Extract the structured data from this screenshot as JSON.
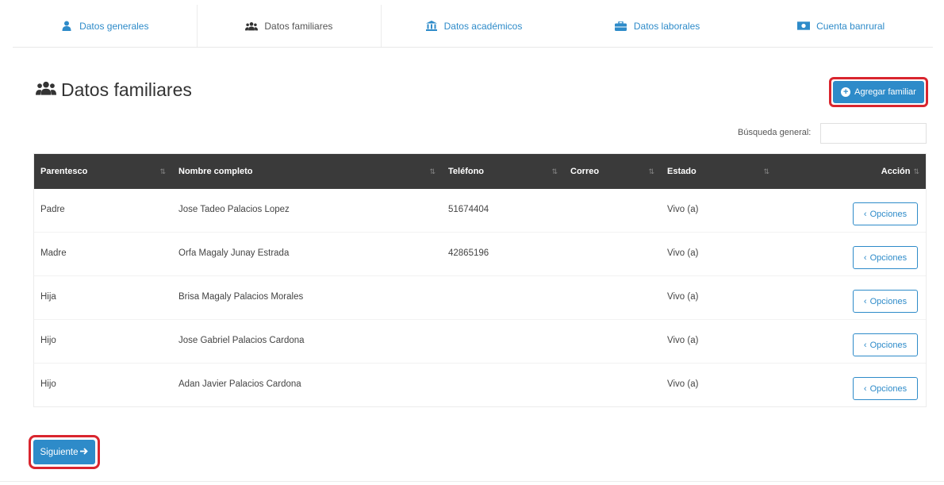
{
  "tabs": [
    {
      "label": "Datos generales",
      "icon": "user-icon"
    },
    {
      "label": "Datos familiares",
      "icon": "users-icon"
    },
    {
      "label": "Datos académicos",
      "icon": "institution-icon"
    },
    {
      "label": "Datos laborales",
      "icon": "briefcase-icon"
    },
    {
      "label": "Cuenta banrural",
      "icon": "money-icon"
    }
  ],
  "active_tab": "Datos familiares",
  "header": {
    "title": "Datos familiares",
    "add_button_label": "Agregar familiar"
  },
  "search": {
    "label": "Búsqueda general:",
    "value": ""
  },
  "table": {
    "columns": [
      "Parentesco",
      "Nombre completo",
      "Teléfono",
      "Correo",
      "Estado",
      "Acción"
    ],
    "rows": [
      {
        "parentesco": "Padre",
        "nombre": "Jose Tadeo Palacios Lopez",
        "telefono": "51674404",
        "correo": "",
        "estado": "Vivo (a)",
        "accion": "Opciones"
      },
      {
        "parentesco": "Madre",
        "nombre": "Orfa Magaly Junay Estrada",
        "telefono": "42865196",
        "correo": "",
        "estado": "Vivo (a)",
        "accion": "Opciones"
      },
      {
        "parentesco": "Hija",
        "nombre": "Brisa Magaly Palacios Morales",
        "telefono": "",
        "correo": "",
        "estado": "Vivo (a)",
        "accion": "Opciones"
      },
      {
        "parentesco": "Hijo",
        "nombre": "Jose Gabriel Palacios Cardona",
        "telefono": "",
        "correo": "",
        "estado": "Vivo (a)",
        "accion": "Opciones"
      },
      {
        "parentesco": "Hijo",
        "nombre": "Adan Javier Palacios Cardona",
        "telefono": "",
        "correo": "",
        "estado": "Vivo (a)",
        "accion": "Opciones"
      }
    ]
  },
  "footer": {
    "next_button_label": "Siguiente"
  },
  "colors": {
    "accent": "#2e8bc9",
    "highlight": "#d9252e",
    "table_header": "#3a3a3a"
  }
}
